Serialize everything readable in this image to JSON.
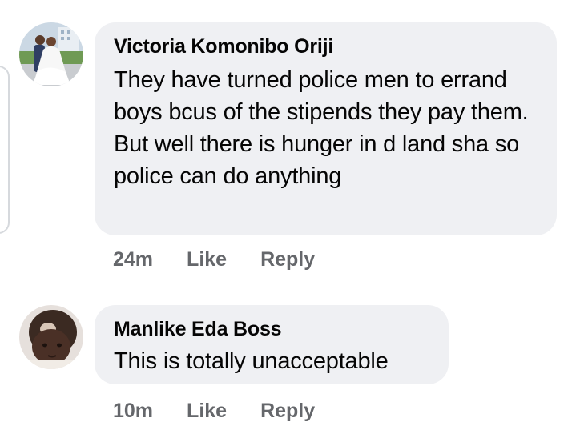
{
  "comments": [
    {
      "author": "Victoria Komonibo Oriji",
      "text": "They have turned police men to errand boys bcus of the stipends they pay them. But well there is hunger in d land sha so police can do anything",
      "time": "24m",
      "like_label": "Like",
      "reply_label": "Reply",
      "avatar_icon": "wedding-couple-avatar"
    },
    {
      "author": "Manlike Eda Boss",
      "text": "This is totally unacceptable",
      "time": "10m",
      "like_label": "Like",
      "reply_label": "Reply",
      "avatar_icon": "child-avatar"
    }
  ],
  "colors": {
    "bubble": "#eff0f3",
    "name": "#050505",
    "meta": "#65676b"
  }
}
